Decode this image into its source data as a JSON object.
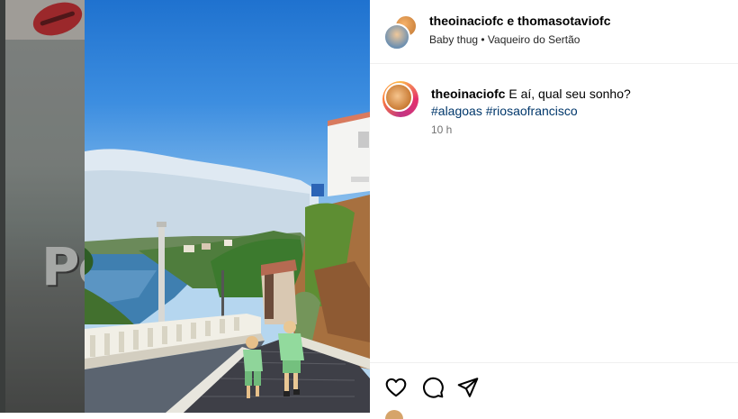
{
  "header": {
    "names": "theoinaciofc e thomasotaviofc",
    "subtitle": "Baby thug • Vaqueiro do Sertão"
  },
  "caption": {
    "username": "theoinaciofc",
    "text": "E aí, qual seu sonho?",
    "hashtags": [
      "#alagoas",
      "#riosaofrancisco"
    ],
    "time": "10 h"
  },
  "media": {
    "ghost_text": "Pe"
  },
  "actions": {
    "like_icon": "heart-icon",
    "comment_icon": "comment-icon",
    "share_icon": "send-icon"
  },
  "colors": {
    "hashtag": "#00376b",
    "time": "#737373",
    "sky": "#2f80d8"
  }
}
